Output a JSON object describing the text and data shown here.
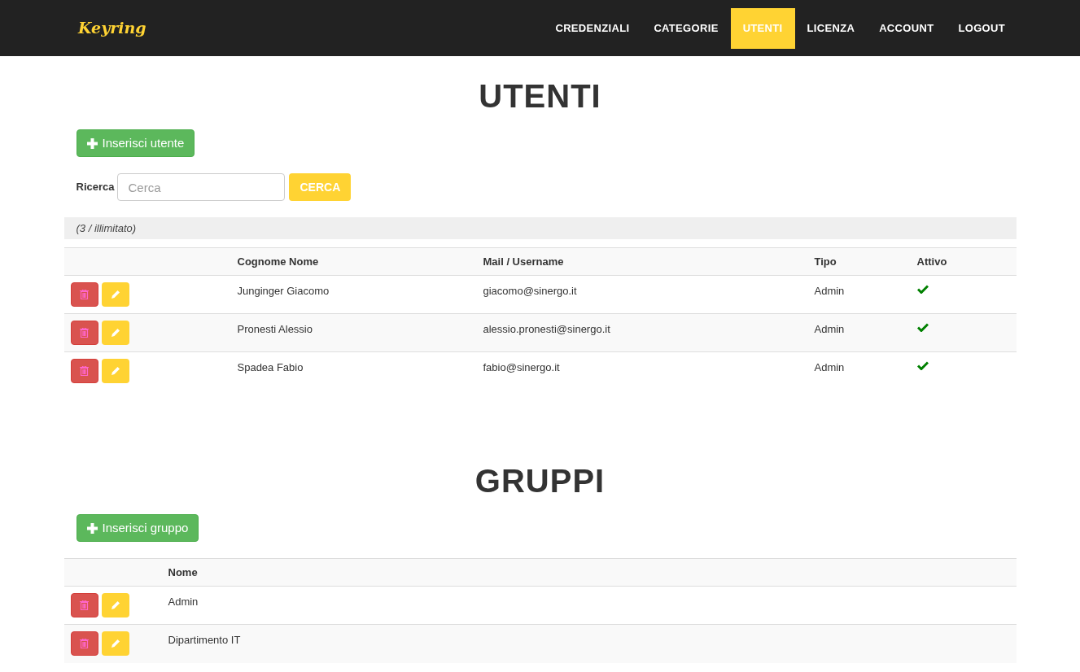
{
  "nav": {
    "brand": "Keyring",
    "items": [
      {
        "label": "CREDENZIALI",
        "selected": false
      },
      {
        "label": "CATEGORIE",
        "selected": false
      },
      {
        "label": "UTENTI",
        "selected": true
      },
      {
        "label": "LICENZA",
        "selected": false
      },
      {
        "label": "ACCOUNT",
        "selected": false
      },
      {
        "label": "LOGOUT",
        "selected": false
      }
    ]
  },
  "users": {
    "title": "UTENTI",
    "add_button": "Inserisci utente",
    "search": {
      "label": "Ricerca",
      "placeholder": "Cerca",
      "button": "CERCA"
    },
    "count": "(3 / illimitato)",
    "columns": [
      "Cognome Nome",
      "Mail / Username",
      "Tipo",
      "Attivo"
    ],
    "rows": [
      {
        "name": "Junginger Giacomo",
        "mail": "giacomo@sinergo.it",
        "type": "Admin",
        "active": true
      },
      {
        "name": "Pronesti Alessio",
        "mail": "alessio.pronesti@sinergo.it",
        "type": "Admin",
        "active": true
      },
      {
        "name": "Spadea Fabio",
        "mail": "fabio@sinergo.it",
        "type": "Admin",
        "active": true
      }
    ]
  },
  "groups": {
    "title": "GRUPPI",
    "add_button": "Inserisci gruppo",
    "columns": [
      "Nome"
    ],
    "rows": [
      {
        "name": "Admin"
      },
      {
        "name": "Dipartimento IT"
      }
    ]
  }
}
